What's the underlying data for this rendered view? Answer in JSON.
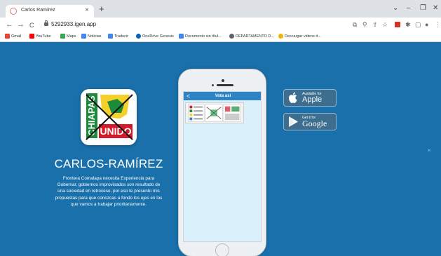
{
  "browser": {
    "tab": {
      "title": "Carlos Ramírez",
      "close": "×"
    },
    "new_tab": "+",
    "window": {
      "chevron": "⌄",
      "minimize": "–",
      "maximize": "❐",
      "close": "✕"
    },
    "nav": {
      "back": "←",
      "forward": "→",
      "reload": "C"
    },
    "url": "5292933.igen.app",
    "toolbar_icons": [
      "lens-icon",
      "zoom-icon",
      "share-icon",
      "star-icon",
      "extension-icon",
      "puzzle-icon",
      "sidebar-icon",
      "profile-icon",
      "menu-icon"
    ],
    "bookmarks": [
      {
        "label": "Gmail",
        "icon": "gmail-icon",
        "color": "#ea4335"
      },
      {
        "label": "YouTube",
        "icon": "youtube-icon",
        "color": "#ff0000"
      },
      {
        "label": "Maps",
        "icon": "maps-icon",
        "color": "#34a853"
      },
      {
        "label": "Noticias",
        "icon": "news-icon",
        "color": "#4285f4"
      },
      {
        "label": "Traducir",
        "icon": "translate-icon",
        "color": "#4285f4"
      },
      {
        "label": "OneDrive Genesis",
        "icon": "onedrive-icon",
        "color": "#0364b8"
      },
      {
        "label": "Documento sin títul...",
        "icon": "docs-icon",
        "color": "#4285f4"
      },
      {
        "label": "DEPARTAMENTO D...",
        "icon": "globe-icon",
        "color": "#5f6368"
      },
      {
        "label": "Descargar videos d...",
        "icon": "download-icon",
        "color": "#f4b400"
      }
    ]
  },
  "page": {
    "logo": {
      "vertical_text": "CHIAPAS",
      "badge_text": "UNIDO",
      "icon": "chiapas-unido-logo",
      "colors": {
        "green": "#1b8a3a",
        "red": "#d11b2a",
        "yellow": "#f5d02a"
      }
    },
    "candidate_name": "CARLOS-RAMÍREZ",
    "bio": "Frontera Comalapa necesita Experiencia para Gobernar, gobiernos improvisados son resultado de una sociedad en retroceso, por eso te presento mis propuestas para que conozcas a fondo los ejes en los que vamos a trabajar prioritariamente.",
    "phone": {
      "header_title": "Vota así",
      "back": "<"
    },
    "stores": {
      "apple": {
        "small": "Available for",
        "big": "Apple",
        "icon": "apple-icon"
      },
      "google": {
        "small": "Get it for",
        "big": "Google",
        "icon": "google-play-icon"
      }
    },
    "close_overlay": "×"
  },
  "colors": {
    "page_bg": "#1a70aa",
    "app_header": "#2d83c3",
    "badge_bg": "#3d6e8f"
  }
}
